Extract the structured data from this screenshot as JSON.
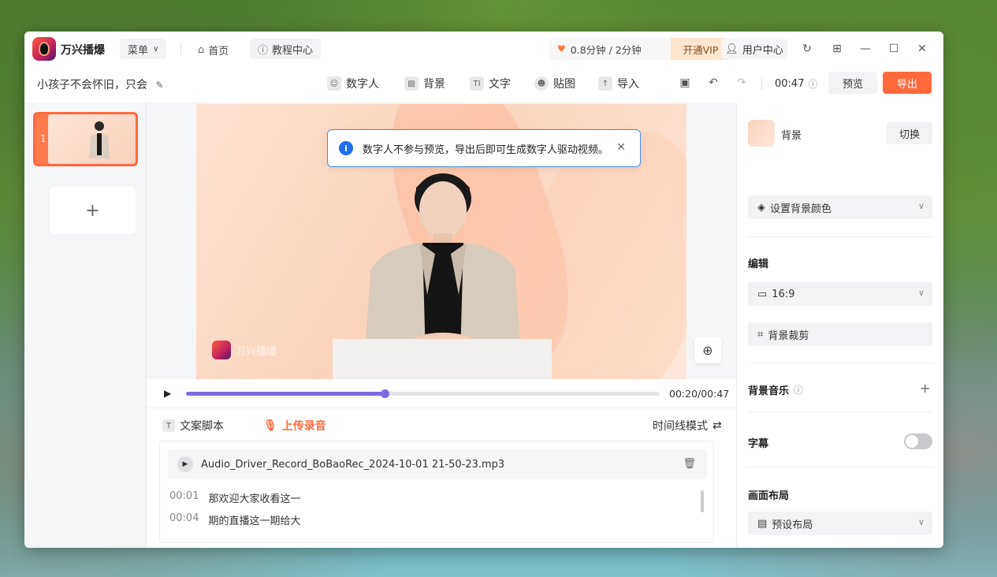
{
  "app": {
    "name": "万兴播爆",
    "menu_label": "菜单",
    "home_label": "首页",
    "tutorial_label": "教程中心",
    "usage_text": "0.8分钟 / 2分钟",
    "vip_label": "开通VIP",
    "user_center_label": "用户中心"
  },
  "toolbar": {
    "project_name": "小孩子不会怀旧，只会",
    "tools": [
      "数字人",
      "背景",
      "文字",
      "贴图",
      "导入"
    ],
    "duration": "00:47",
    "preview_label": "预览",
    "export_label": "导出"
  },
  "scenes": {
    "items": [
      {
        "index": "1"
      }
    ],
    "add_label": "+"
  },
  "canvas": {
    "toast_message": "数字人不参与预览，导出后即可生成数字人驱动视频。",
    "watermark_text": "万兴播爆"
  },
  "player": {
    "current_time": "00:20",
    "total_time": "00:47",
    "time_display": "00:20/00:47",
    "progress": 0.42
  },
  "script": {
    "tab_script": "文案脚本",
    "tab_upload": "上传录音",
    "timeline_mode": "时间线模式",
    "audio_file": "Audio_Driver_Record_BoBaoRec_2024-10-01 21-50-23.mp3",
    "lines": [
      {
        "time": "00:01",
        "text": "那欢迎大家收看这一"
      },
      {
        "time": "00:04",
        "text": "期的直播这一期给大"
      }
    ]
  },
  "panel": {
    "background_label": "背景",
    "switch_label": "切换",
    "set_bg_color": "设置背景颜色",
    "edit_title": "编辑",
    "aspect_ratio": "16:9",
    "bg_crop": "背景裁剪",
    "bg_music": "背景音乐",
    "subtitle": "字幕",
    "subtitle_on": false,
    "layout_title": "画面布局",
    "preset_layout": "预设布局"
  },
  "colors": {
    "accent": "#ff6a3d",
    "progress": "#7d6be0",
    "info": "#1f6ff0"
  }
}
